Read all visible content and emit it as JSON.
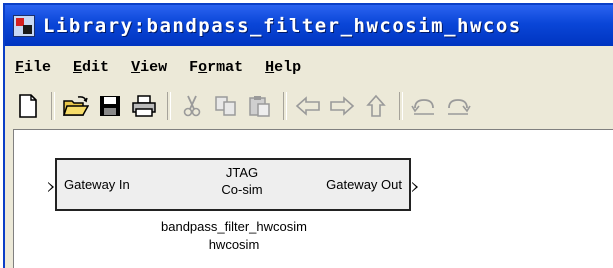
{
  "window": {
    "title": "Library:bandpass_filter_hwcosim_hwcos",
    "icon": "simulink-library-icon"
  },
  "menubar": {
    "items": [
      {
        "first": "F",
        "rest": "ile"
      },
      {
        "first": "E",
        "rest": "dit"
      },
      {
        "first": "V",
        "rest": "iew"
      },
      {
        "first": "F",
        "rest": "ormat",
        "prefix": ""
      },
      {
        "first": "H",
        "rest": "elp"
      }
    ]
  },
  "toolbar": {
    "buttons": [
      "new-icon",
      "open-icon",
      "save-icon",
      "print-icon",
      "cut-icon",
      "copy-icon",
      "paste-icon",
      "back-icon",
      "forward-icon",
      "up-icon",
      "undo-icon",
      "redo-icon"
    ]
  },
  "block": {
    "input_label": "Gateway In",
    "output_label": "Gateway Out",
    "center_line1": "JTAG",
    "center_line2": "Co-sim",
    "name_line1": "bandpass_filter_hwcosim",
    "name_line2": "hwcosim"
  }
}
